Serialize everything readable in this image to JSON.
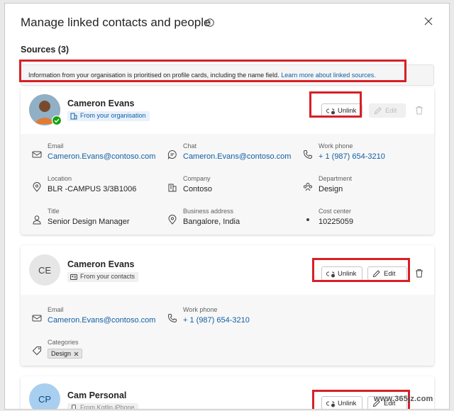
{
  "dialog": {
    "title": "Manage linked contacts and people",
    "sources_label": "Sources (3)",
    "banner_text": "Information from your organisation is prioritised on profile cards, including the name field.",
    "banner_link": "Learn more about linked sources."
  },
  "cards": [
    {
      "name": "Cameron Evans",
      "source": "From your organisation",
      "unlink_label": "Unlink",
      "edit_label": "Edit",
      "fields": [
        {
          "label": "Email",
          "value": "Cameron.Evans@contoso.com",
          "icon": "mail-icon"
        },
        {
          "label": "Chat",
          "value": "Cameron.Evans@contoso.com",
          "icon": "chat-icon"
        },
        {
          "label": "Work phone",
          "value": "+ 1 (987) 654-3210",
          "icon": "phone-icon"
        },
        {
          "label": "Location",
          "value": "BLR -CAMPUS 3/3B1006",
          "icon": "location-icon"
        },
        {
          "label": "Company",
          "value": "Contoso",
          "icon": "building-icon"
        },
        {
          "label": "Department",
          "value": "Design",
          "icon": "people-icon"
        },
        {
          "label": "Title",
          "value": "Senior Design Manager",
          "icon": "person-icon"
        },
        {
          "label": "Business address",
          "value": "Bangalore, India",
          "icon": "location-icon"
        },
        {
          "label": "Cost  center",
          "value": "10225059",
          "icon": "dot-icon"
        }
      ]
    },
    {
      "name": "Cameron Evans",
      "initials": "CE",
      "source": "From your contacts",
      "unlink_label": "Unlink",
      "edit_label": "Edit",
      "fields": [
        {
          "label": "Email",
          "value": "Cameron.Evans@contoso.com",
          "icon": "mail-icon"
        },
        {
          "label": "Work phone",
          "value": "+ 1 (987) 654-3210",
          "icon": "phone-icon"
        },
        {
          "label": "Categories",
          "value": "Design",
          "icon": "tag-icon"
        }
      ]
    },
    {
      "name": "Cam Personal",
      "initials": "CP",
      "source": "From Kotlin iPhone",
      "unlink_label": "Unlink",
      "edit_label": "Edit"
    }
  ],
  "watermark": "www.365jz.com",
  "colors": {
    "accent": "#115ea3",
    "highlight": "#d81f26",
    "presence": "#13a10e"
  }
}
